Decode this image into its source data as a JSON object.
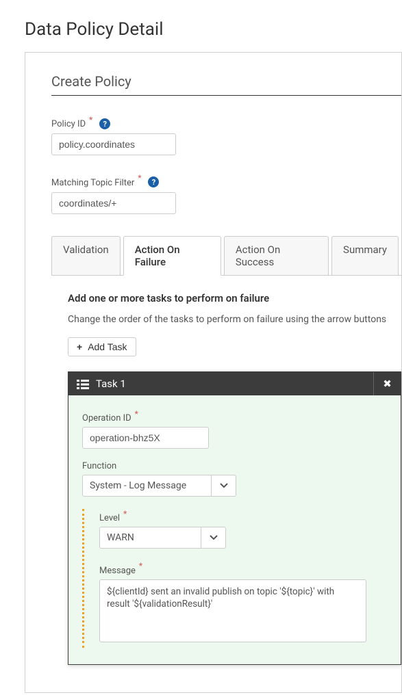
{
  "pageTitle": "Data Policy Detail",
  "panelTitle": "Create Policy",
  "policyId": {
    "label": "Policy ID",
    "value": "policy.coordinates"
  },
  "topicFilter": {
    "label": "Matching Topic Filter",
    "value": "coordinates/+"
  },
  "tabs": {
    "validation": "Validation",
    "failure": "Action On Failure",
    "success": "Action On Success",
    "summary": "Summary"
  },
  "failureSection": {
    "heading": "Add one or more tasks to perform on failure",
    "description": "Change the order of the tasks to perform on failure using the arrow buttons",
    "addTaskLabel": "Add Task"
  },
  "task": {
    "title": "Task 1",
    "operationId": {
      "label": "Operation ID",
      "value": "operation-bhz5X"
    },
    "function": {
      "label": "Function",
      "value": "System - Log Message"
    },
    "level": {
      "label": "Level",
      "value": "WARN"
    },
    "message": {
      "label": "Message",
      "value": "${clientId} sent an invalid publish on topic '${topic}' with result '${validationResult}'"
    }
  }
}
